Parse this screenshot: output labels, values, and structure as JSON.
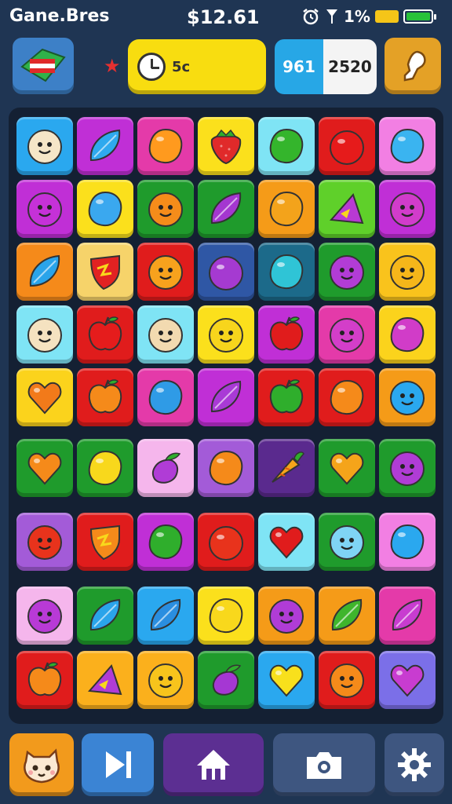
{
  "status_bar": {
    "title": "Gane.Bres",
    "price": "$12.61",
    "battery_percent": "1%"
  },
  "hud": {
    "timer_value": "5c",
    "score_left": "961",
    "score_right": "2520"
  },
  "board": {
    "rows": [
      [
        {
          "bg": "#2aa8ef",
          "shape": "face",
          "c": "#f5e6c8"
        },
        {
          "bg": "#c02fd6",
          "shape": "leaf",
          "c": "#2ea9ee"
        },
        {
          "bg": "#e43aa9",
          "shape": "blob",
          "c": "#ff9a1e"
        },
        {
          "bg": "#fbe01c",
          "shape": "strawberry",
          "c": "#e02a2a"
        },
        {
          "bg": "#7fe4f5",
          "shape": "blob",
          "c": "#34b52c"
        },
        {
          "bg": "#e01c1c",
          "shape": "round",
          "c": "#e61b1b"
        },
        {
          "bg": "#f27fe3",
          "shape": "blob",
          "c": "#3ab4f0"
        }
      ],
      [
        {
          "bg": "#c02fd6",
          "shape": "face",
          "c": "#c531d8"
        },
        {
          "bg": "#fbe01c",
          "shape": "blob",
          "c": "#3aa8ef"
        },
        {
          "bg": "#1f9b2c",
          "shape": "face",
          "c": "#f58c1a"
        },
        {
          "bg": "#1f9b2c",
          "shape": "leaf",
          "c": "#a437d0"
        },
        {
          "bg": "#f59b18",
          "shape": "blob",
          "c": "#f3a31b"
        },
        {
          "bg": "#5fd02a",
          "shape": "triangle",
          "c": "#b83ad3"
        },
        {
          "bg": "#c02fd6",
          "shape": "face",
          "c": "#d13ccb"
        }
      ],
      [
        {
          "bg": "#f58a1a",
          "shape": "leaf",
          "c": "#2aa4ea"
        },
        {
          "bg": "#f6d36a",
          "shape": "shield",
          "c": "#e22222"
        },
        {
          "bg": "#e01c1c",
          "shape": "face",
          "c": "#f7a21d"
        },
        {
          "bg": "#2f57a5",
          "shape": "round",
          "c": "#a53ad1"
        },
        {
          "bg": "#1c6a8a",
          "shape": "blob",
          "c": "#2fc4d6"
        },
        {
          "bg": "#1f9b2c",
          "shape": "face",
          "c": "#b23cd6"
        },
        {
          "bg": "#f9c31c",
          "shape": "face",
          "c": "#f5b61a"
        }
      ],
      [
        {
          "bg": "#7fe4f5",
          "shape": "face",
          "c": "#f5e2c0"
        },
        {
          "bg": "#e01c1c",
          "shape": "apple",
          "c": "#e51c1c"
        },
        {
          "bg": "#7fe4f5",
          "shape": "face",
          "c": "#f2dab0"
        },
        {
          "bg": "#fbe01c",
          "shape": "face",
          "c": "#f7d51c"
        },
        {
          "bg": "#c02fd6",
          "shape": "apple",
          "c": "#e01c1c"
        },
        {
          "bg": "#e43aa9",
          "shape": "face",
          "c": "#d33ec9"
        },
        {
          "bg": "#fbd31c",
          "shape": "blob",
          "c": "#d13cc8"
        }
      ],
      [
        {
          "bg": "#fbd31c",
          "shape": "heart",
          "c": "#f27a1a"
        },
        {
          "bg": "#e01c1c",
          "shape": "apple",
          "c": "#f58a1a"
        },
        {
          "bg": "#e43aa9",
          "shape": "blob",
          "c": "#2f9be6"
        },
        {
          "bg": "#c02fd6",
          "shape": "leaf",
          "c": "#a93ad6"
        },
        {
          "bg": "#e01c1c",
          "shape": "apple",
          "c": "#2fae2c"
        },
        {
          "bg": "#e01c1c",
          "shape": "blob",
          "c": "#f58a1a"
        },
        {
          "bg": "#f59b18",
          "shape": "face",
          "c": "#2aa8ef"
        }
      ],
      [
        {
          "bg": "#1f9b2c",
          "shape": "heart",
          "c": "#f58a1a"
        },
        {
          "bg": "#1f9b2c",
          "shape": "blob",
          "c": "#f8d81c"
        },
        {
          "bg": "#f5b6ec",
          "shape": "eggplant",
          "c": "#b03cd6"
        },
        {
          "bg": "#a35bd8",
          "shape": "blob",
          "c": "#f58a1a"
        },
        {
          "bg": "#5a2a8e",
          "shape": "carrot",
          "c": "#f5a41a"
        },
        {
          "bg": "#1f9b2c",
          "shape": "heart",
          "c": "#f5a41a"
        },
        {
          "bg": "#1f9b2c",
          "shape": "face",
          "c": "#b03cd6"
        }
      ],
      [
        {
          "bg": "#a35bd8",
          "shape": "face",
          "c": "#e8331c"
        },
        {
          "bg": "#e01c1c",
          "shape": "shield",
          "c": "#f58a1a"
        },
        {
          "bg": "#c02fd6",
          "shape": "blob",
          "c": "#2fae2c"
        },
        {
          "bg": "#e01c1c",
          "shape": "round",
          "c": "#e8331c"
        },
        {
          "bg": "#7fe4f5",
          "shape": "heart",
          "c": "#e01c1c"
        },
        {
          "bg": "#1f9b2c",
          "shape": "face",
          "c": "#7fd4f5"
        },
        {
          "bg": "#f27fe3",
          "shape": "blob",
          "c": "#2aa8ef"
        }
      ],
      [
        {
          "bg": "#f5b6ec",
          "shape": "face",
          "c": "#b83ad6"
        },
        {
          "bg": "#1f9b2c",
          "shape": "leaf",
          "c": "#2aa4ea"
        },
        {
          "bg": "#2aa8ef",
          "shape": "leaf",
          "c": "#2a8ee0"
        },
        {
          "bg": "#fbe01c",
          "shape": "blob",
          "c": "#f8d81c"
        },
        {
          "bg": "#f59b18",
          "shape": "face",
          "c": "#b03cd6"
        },
        {
          "bg": "#f59b18",
          "shape": "leaf",
          "c": "#3fb52c"
        },
        {
          "bg": "#e43aa9",
          "shape": "leaf",
          "c": "#c83cd0"
        }
      ],
      [
        {
          "bg": "#e01c1c",
          "shape": "apple",
          "c": "#f58a1a"
        },
        {
          "bg": "#fbb01c",
          "shape": "triangle",
          "c": "#b03cd6"
        },
        {
          "bg": "#fbb01c",
          "shape": "face",
          "c": "#f7c41c"
        },
        {
          "bg": "#1f9b2c",
          "shape": "eggplant",
          "c": "#a537d3"
        },
        {
          "bg": "#2aa8ef",
          "shape": "heart",
          "c": "#f8e01c"
        },
        {
          "bg": "#e01c1c",
          "shape": "face",
          "c": "#f58a1a"
        },
        {
          "bg": "#7b6fe8",
          "shape": "heart",
          "c": "#c83cd0"
        }
      ]
    ]
  },
  "icons": {
    "flag": "flag-icon",
    "star": "star-icon",
    "timer": "clock-icon",
    "shoe": "boot-icon",
    "character": "character-icon",
    "play": "play-icon",
    "home": "home-icon",
    "camera": "camera-icon",
    "settings": "gear-icon"
  }
}
